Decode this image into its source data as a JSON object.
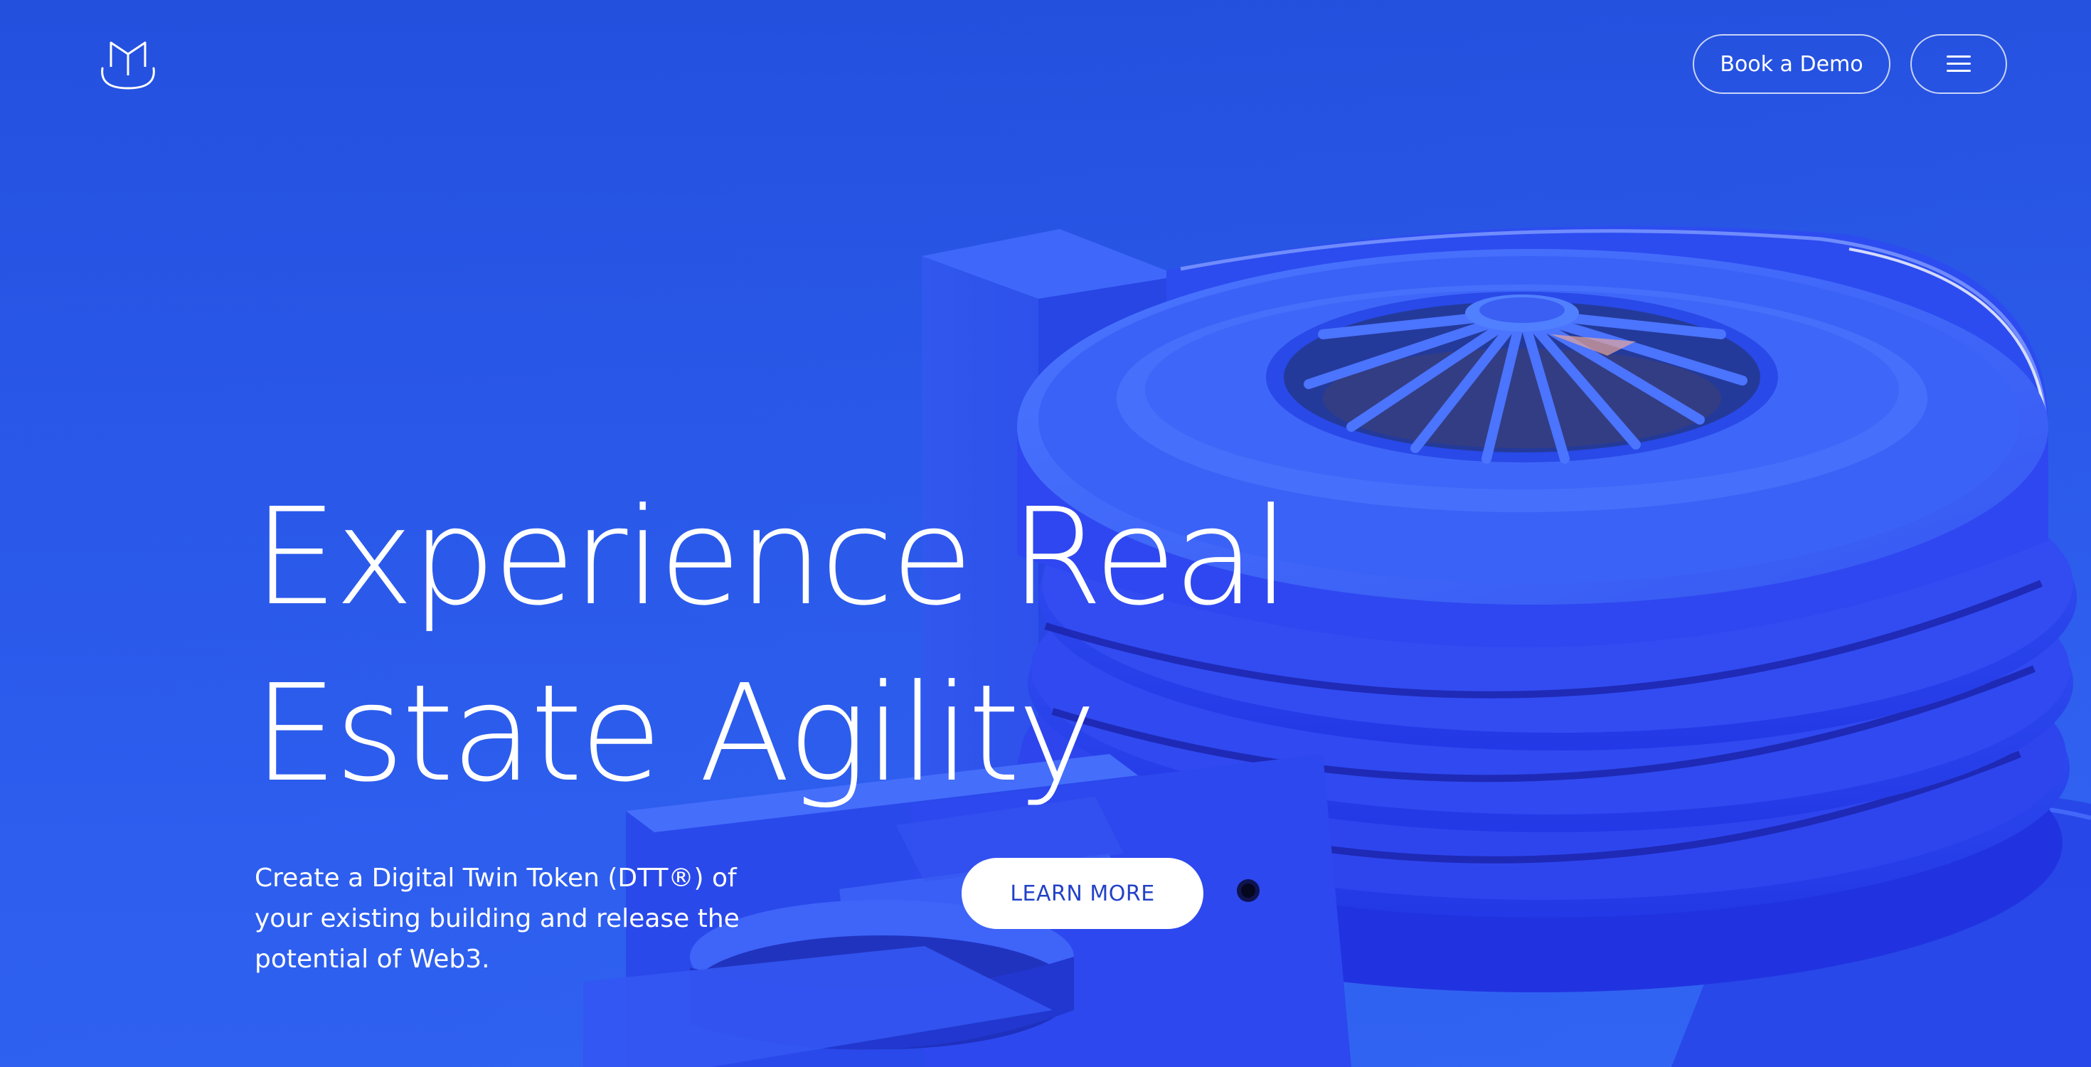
{
  "header": {
    "logo_icon": "cat-m-logo-icon",
    "demo_label": "Book a Demo",
    "menu_icon": "hamburger-menu-icon"
  },
  "hero": {
    "headline_line1": "Experience Real",
    "headline_line2": "Estate Agility",
    "subtext": "Create a Digital Twin Token (DTT®) of your existing building and release the potential of Web3.",
    "cta_label": "LEARN MORE",
    "illustration": "guggenheim-building-render"
  },
  "colors": {
    "background": "#2a55e6",
    "building": "#2f48f0",
    "text": "#ffffff",
    "cta_text": "#2342c8"
  }
}
